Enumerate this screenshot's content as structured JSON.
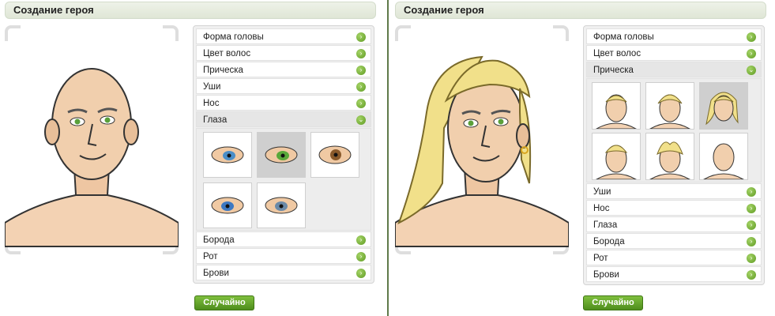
{
  "colors": {
    "accent": "#5e9a22",
    "title_bg": "#e6ece0",
    "selected": "#cfcfcf"
  },
  "left": {
    "title": "Создание героя",
    "menu": [
      {
        "label": "Форма головы"
      },
      {
        "label": "Цвет волос"
      },
      {
        "label": "Прическа"
      },
      {
        "label": "Уши"
      },
      {
        "label": "Нос"
      },
      {
        "label": "Глаза",
        "expanded": true,
        "options_count": 5,
        "selected_option": 2
      },
      {
        "label": "Борода"
      },
      {
        "label": "Рот"
      },
      {
        "label": "Брови"
      }
    ],
    "random_button": "Случайно",
    "icons": {
      "collapsed": "chevron-right-icon",
      "expanded": "chevron-down-icon"
    }
  },
  "right": {
    "title": "Создание героя",
    "menu": [
      {
        "label": "Форма головы"
      },
      {
        "label": "Цвет волос"
      },
      {
        "label": "Прическа",
        "expanded": true,
        "options_count": 6,
        "selected_option": 3
      },
      {
        "label": "Уши"
      },
      {
        "label": "Нос"
      },
      {
        "label": "Глаза"
      },
      {
        "label": "Борода"
      },
      {
        "label": "Рот"
      },
      {
        "label": "Брови"
      }
    ],
    "random_button": "Случайно"
  }
}
